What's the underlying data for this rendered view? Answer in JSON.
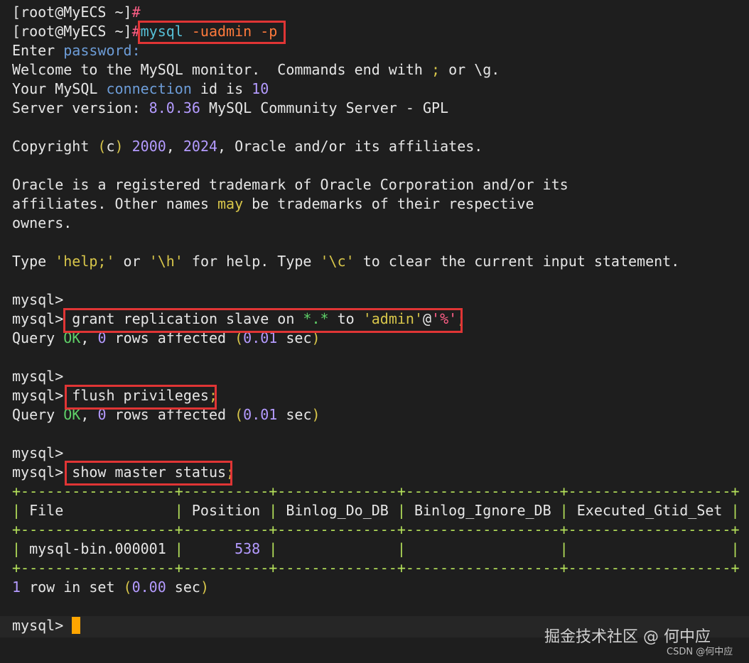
{
  "terminal": {
    "colors": {
      "background": "#1e1e1e",
      "text": "#e6e6e6",
      "highlight_box": "#e03535",
      "cursor": "#ffa500"
    },
    "lines": {
      "l0": {
        "a": "[root@MyECS ~]",
        "b": "#"
      },
      "l1": {
        "a": "[root@MyECS ~]",
        "b": "#",
        "cmd1": "mysql",
        "cmd2": " -uadmin -p"
      },
      "l2": {
        "a": "Enter ",
        "b": "password:"
      },
      "l3": {
        "a": "Welcome to the MySQL monitor.  Commands end with ",
        "b": ";",
        "c": " or \\g."
      },
      "l4": {
        "a": "Your MySQL ",
        "b": "connection",
        "c": " id is ",
        "d": "10"
      },
      "l5": {
        "a": "Server version: ",
        "b": "8.0.36",
        "c": " MySQL Community Server - GPL"
      },
      "l7": {
        "a": "Copyright ",
        "b": "(",
        "c": "c",
        "d": ")",
        "e": " ",
        "f": "2000",
        "g": ", ",
        "h": "2024",
        "i": ", Oracle and/or its affiliates."
      },
      "l9": {
        "a": "Oracle is a registered trademark of Oracle Corporation and/or its"
      },
      "l10": {
        "a": "affiliates. Other names ",
        "b": "may",
        "c": " be trademarks of their respective"
      },
      "l11": {
        "a": "owners."
      },
      "l13": {
        "a": "Type ",
        "b": "'help;'",
        "c": " or ",
        "d": "'\\h'",
        "e": " for help. Type ",
        "f": "'\\c'",
        "g": " to clear the current input statement."
      },
      "l15": {
        "a": "mysql>"
      },
      "l16": {
        "a": "mysql>",
        "b": " grant replication slave on ",
        "c": "*.*",
        "d": " to ",
        "e": "'admin'",
        "f": "@",
        "g": "'%'",
        "h": ";"
      },
      "l17": {
        "a": "Query ",
        "b": "OK",
        "c": ", ",
        "d": "0",
        "e": " rows affected ",
        "f": "(",
        "g": "0.01",
        "h": " sec",
        "i": ")"
      },
      "l19": {
        "a": "mysql>"
      },
      "l20": {
        "a": "mysql>",
        "b": " flush privileges",
        "c": ";"
      },
      "l21": {
        "a": "Query ",
        "b": "OK",
        "c": ", ",
        "d": "0",
        "e": " rows affected ",
        "f": "(",
        "g": "0.01",
        "h": " sec",
        "i": ")"
      },
      "l23": {
        "a": "mysql>"
      },
      "l24": {
        "a": "mysql>",
        "b": " show master status",
        "c": ";"
      },
      "l25": {
        "a": "+------------------+----------+--------------+------------------+-------------------+"
      },
      "l26": {
        "a": "| ",
        "b": "File",
        "c": "             | ",
        "d": "Position",
        "e": " | ",
        "f": "Binlog_Do_DB",
        "g": " | ",
        "h": "Binlog_Ignore_DB",
        "i": " | ",
        "j": "Executed_Gtid_Set",
        "k": " |"
      },
      "l27": {
        "a": "+------------------+----------+--------------+------------------+-------------------+"
      },
      "l28": {
        "a": "| ",
        "b": "mysql-bin.000001",
        "c": " |      ",
        "d": "538",
        "e": " |              |                  |                   |"
      },
      "l29": {
        "a": "+------------------+----------+--------------+------------------+-------------------+"
      },
      "l30": {
        "a": "1",
        "b": " row in set ",
        "c": "(",
        "d": "0.00",
        "e": " sec",
        "f": ")"
      },
      "l32": {
        "a": "mysql> "
      }
    }
  },
  "watermark": {
    "main": "掘金技术社区 @ 何中应",
    "small": "CSDN @何中应"
  }
}
